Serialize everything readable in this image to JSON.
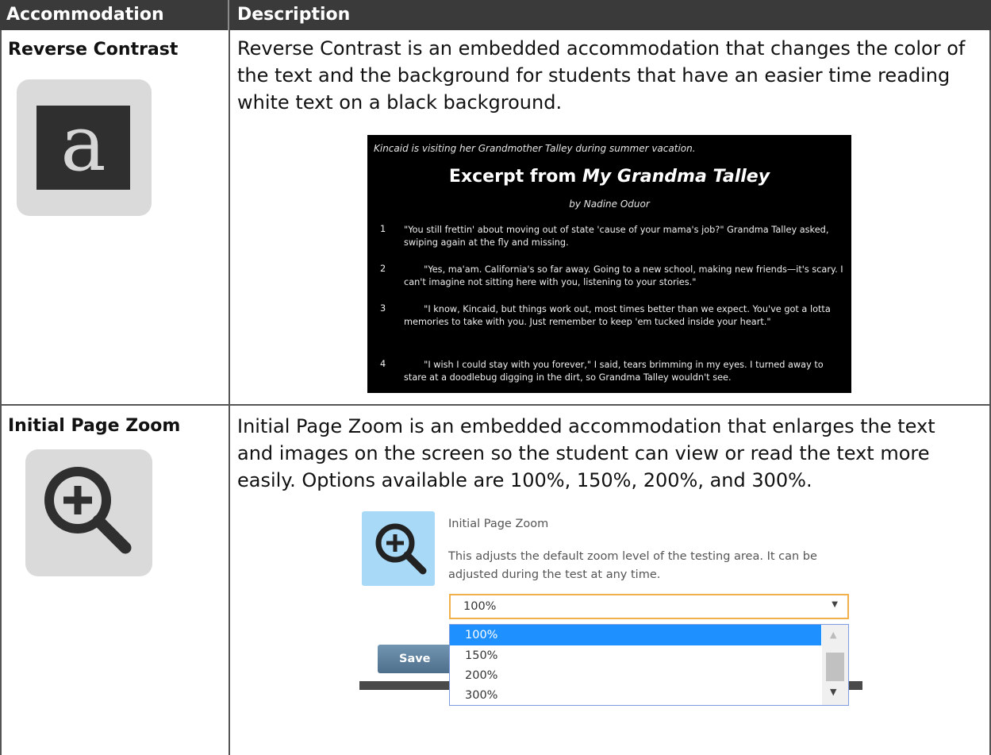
{
  "table": {
    "headers": {
      "accommodation": "Accommodation",
      "description": "Description"
    },
    "rows": [
      {
        "name": "Reverse Contrast",
        "icon": "reverse-contrast-a-icon",
        "icon_letter": "a",
        "description": "Reverse Contrast is an embedded accommodation that changes the color of the text and the background for students that have an easier time reading white text on a black background.",
        "sample": {
          "intro": "Kincaid is visiting her Grandmother Talley during summer vacation.",
          "title_prefix": "Excerpt from ",
          "title_italic": "My Grandma Talley",
          "author": "by Nadine Oduor",
          "paragraphs": [
            {
              "num": "1",
              "text": "\"You still frettin' about moving out of state 'cause of your mama's job?\" Grandma Talley asked, swiping again at the fly and missing."
            },
            {
              "num": "2",
              "text": "       \"Yes, ma'am. California's so far away. Going to a new school, making new friends—it's scary. I can't imagine not sitting here with you, listening to your stories.\""
            },
            {
              "num": "3",
              "text": "       \"I know, Kincaid, but things work out, most times better than we expect. You've got a lotta memories to take with you. Just remember to keep 'em tucked inside your heart.\""
            },
            {
              "num": "4",
              "text": "       \"I wish I could stay with you forever,\" I said, tears brimming in my eyes. I turned away to stare at a doodlebug digging in the dirt, so Grandma Talley wouldn't see."
            }
          ]
        }
      },
      {
        "name": "Initial Page Zoom",
        "icon": "zoom-in-magnifier-icon",
        "description": "Initial Page Zoom is an embedded accommodation that enlarges the text and images on the screen so the student can view or read the text more easily. Options available are 100%, 150%, 200%, and 300%.",
        "sample": {
          "heading": "Initial Page Zoom",
          "desc": "This adjusts the default zoom level of the testing area. It can be adjusted during the test at any time.",
          "selected_value": "100%",
          "options": [
            "100%",
            "150%",
            "200%",
            "300%"
          ],
          "highlighted_option_index": 0,
          "save_label": "Save"
        }
      }
    ]
  },
  "colors": {
    "header_bg": "#3a3a3a",
    "icon_tile_bg": "#dadada",
    "zoom_icon_bg": "#a8daf7",
    "selected_option_bg": "#1e90ff",
    "select_border": "#f2b04a",
    "save_button": "#5a7d9a"
  }
}
